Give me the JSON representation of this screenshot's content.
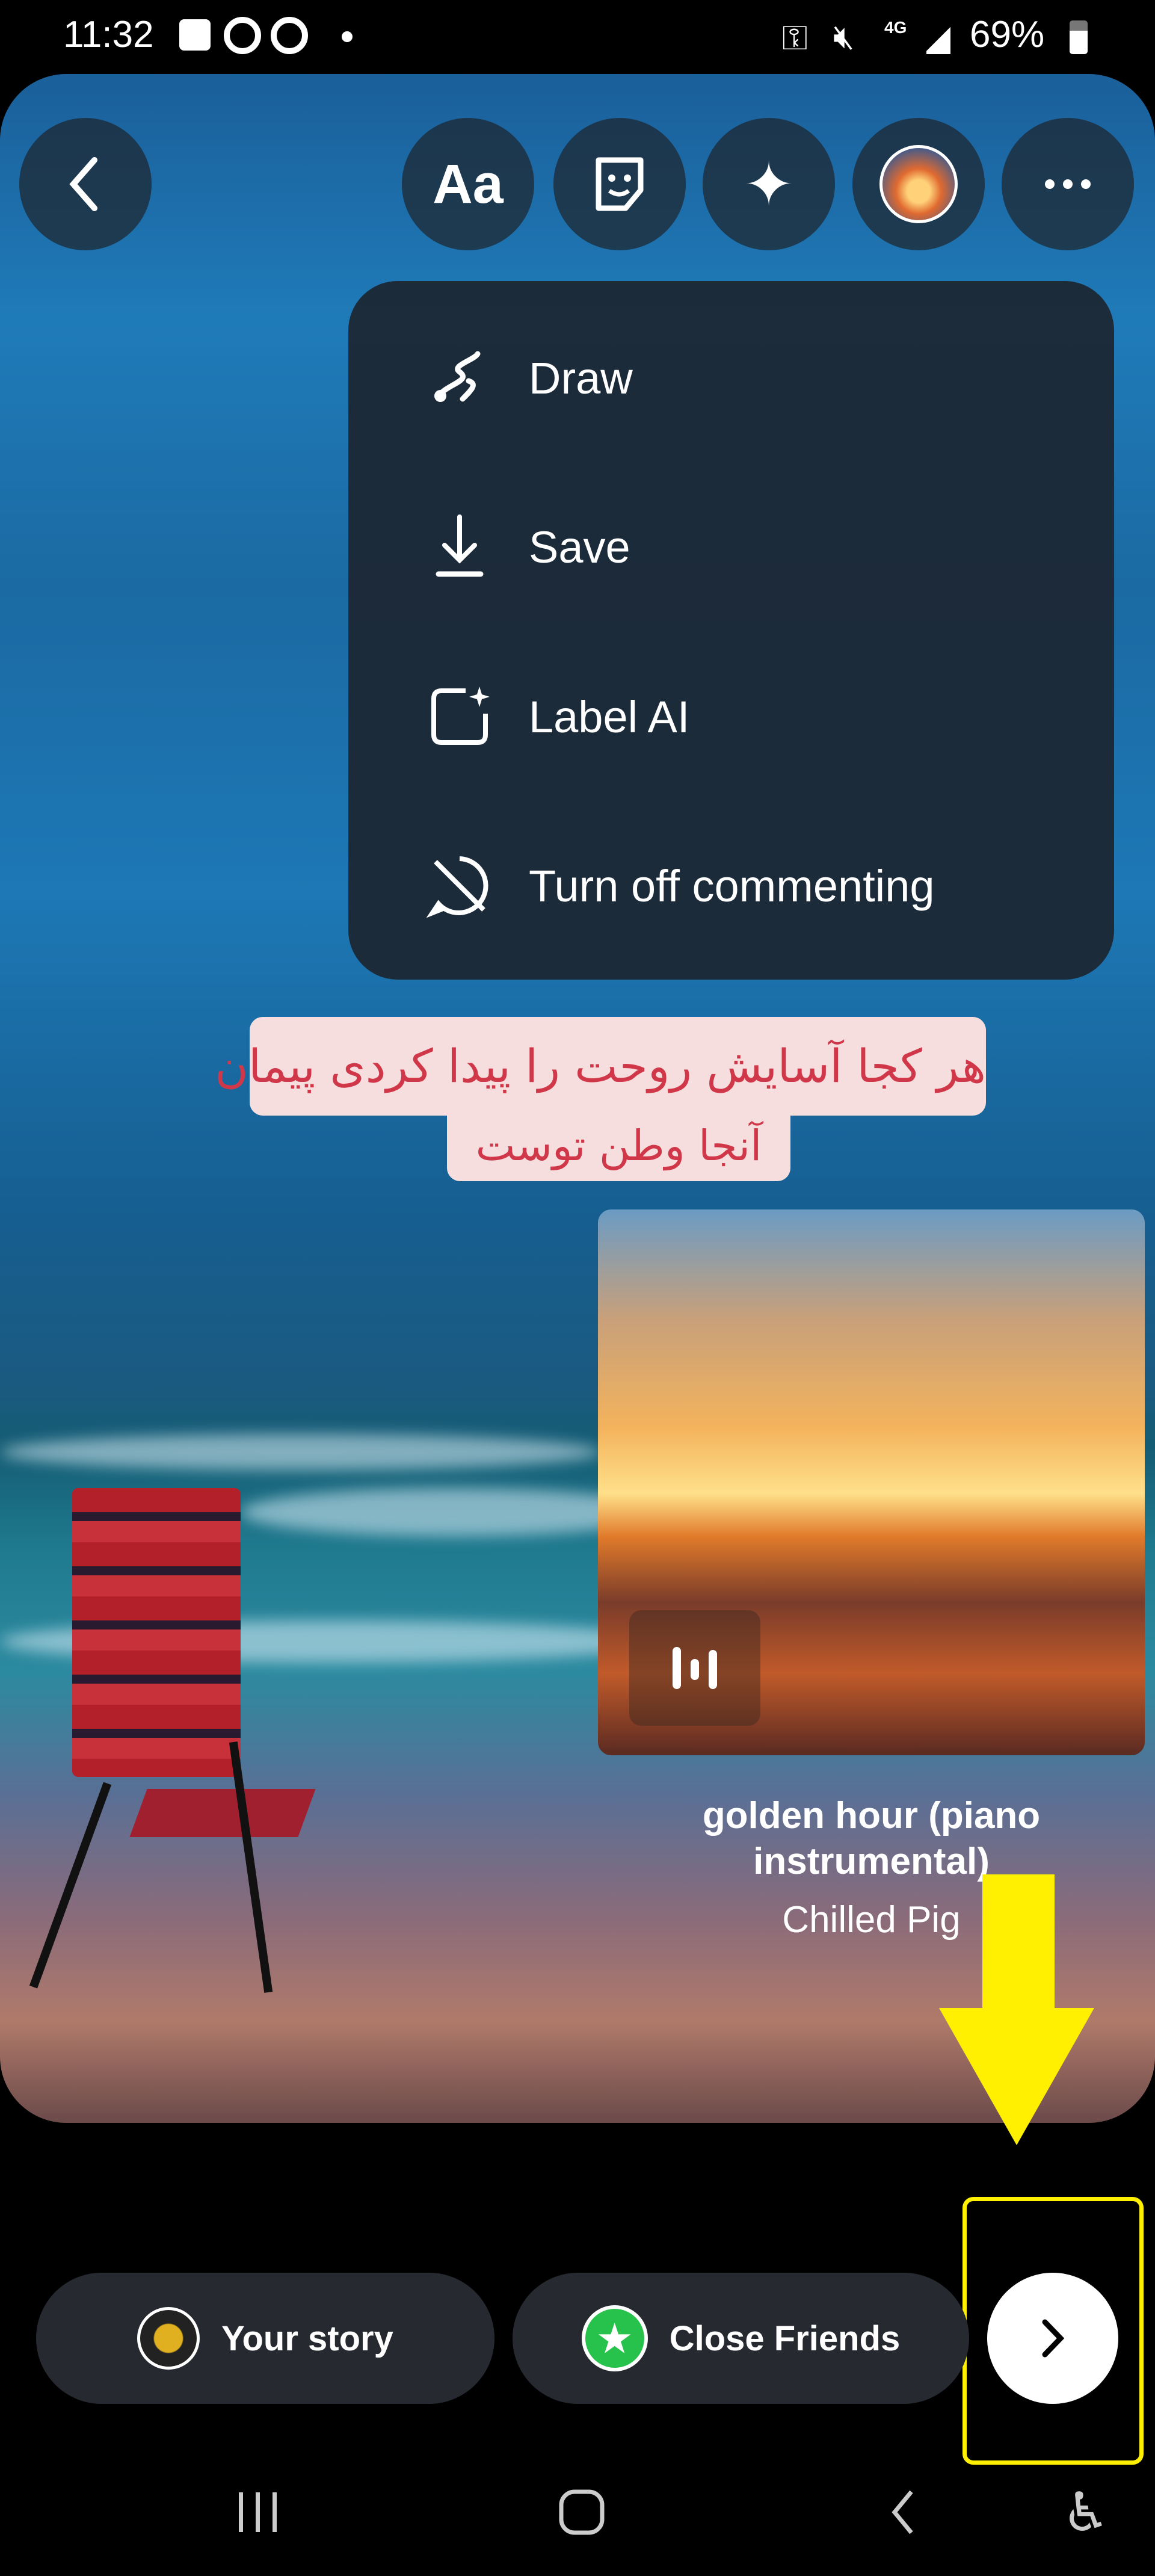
{
  "status_bar": {
    "time": "11:32",
    "network": "4G",
    "battery": "69%"
  },
  "toolbar": {
    "back": "back-icon",
    "text_tool": "Aa",
    "sticker": "sticker-icon",
    "effects": "sparkles-icon",
    "avatar": "profile-avatar",
    "more": "more-icon"
  },
  "menu": {
    "items": [
      {
        "label": "Draw",
        "icon": "draw-icon"
      },
      {
        "label": "Save",
        "icon": "download-icon"
      },
      {
        "label": "Label AI",
        "icon": "label-ai-icon"
      },
      {
        "label": "Turn off commenting",
        "icon": "comment-off-icon"
      }
    ]
  },
  "text_sticker": {
    "line1": "هر کجا آسایش روحت را پیدا کردی پیمان",
    "line2": "آنجا وطن توست"
  },
  "music": {
    "title": "golden hour (piano instrumental)",
    "artist": "Chilled Pig"
  },
  "share": {
    "your_story": "Your story",
    "close_friends": "Close Friends"
  },
  "colors": {
    "annotation": "#ffef00",
    "close_friends": "#27c24c",
    "pill_bg": "#262a30",
    "menu_bg": "#1c2630"
  }
}
